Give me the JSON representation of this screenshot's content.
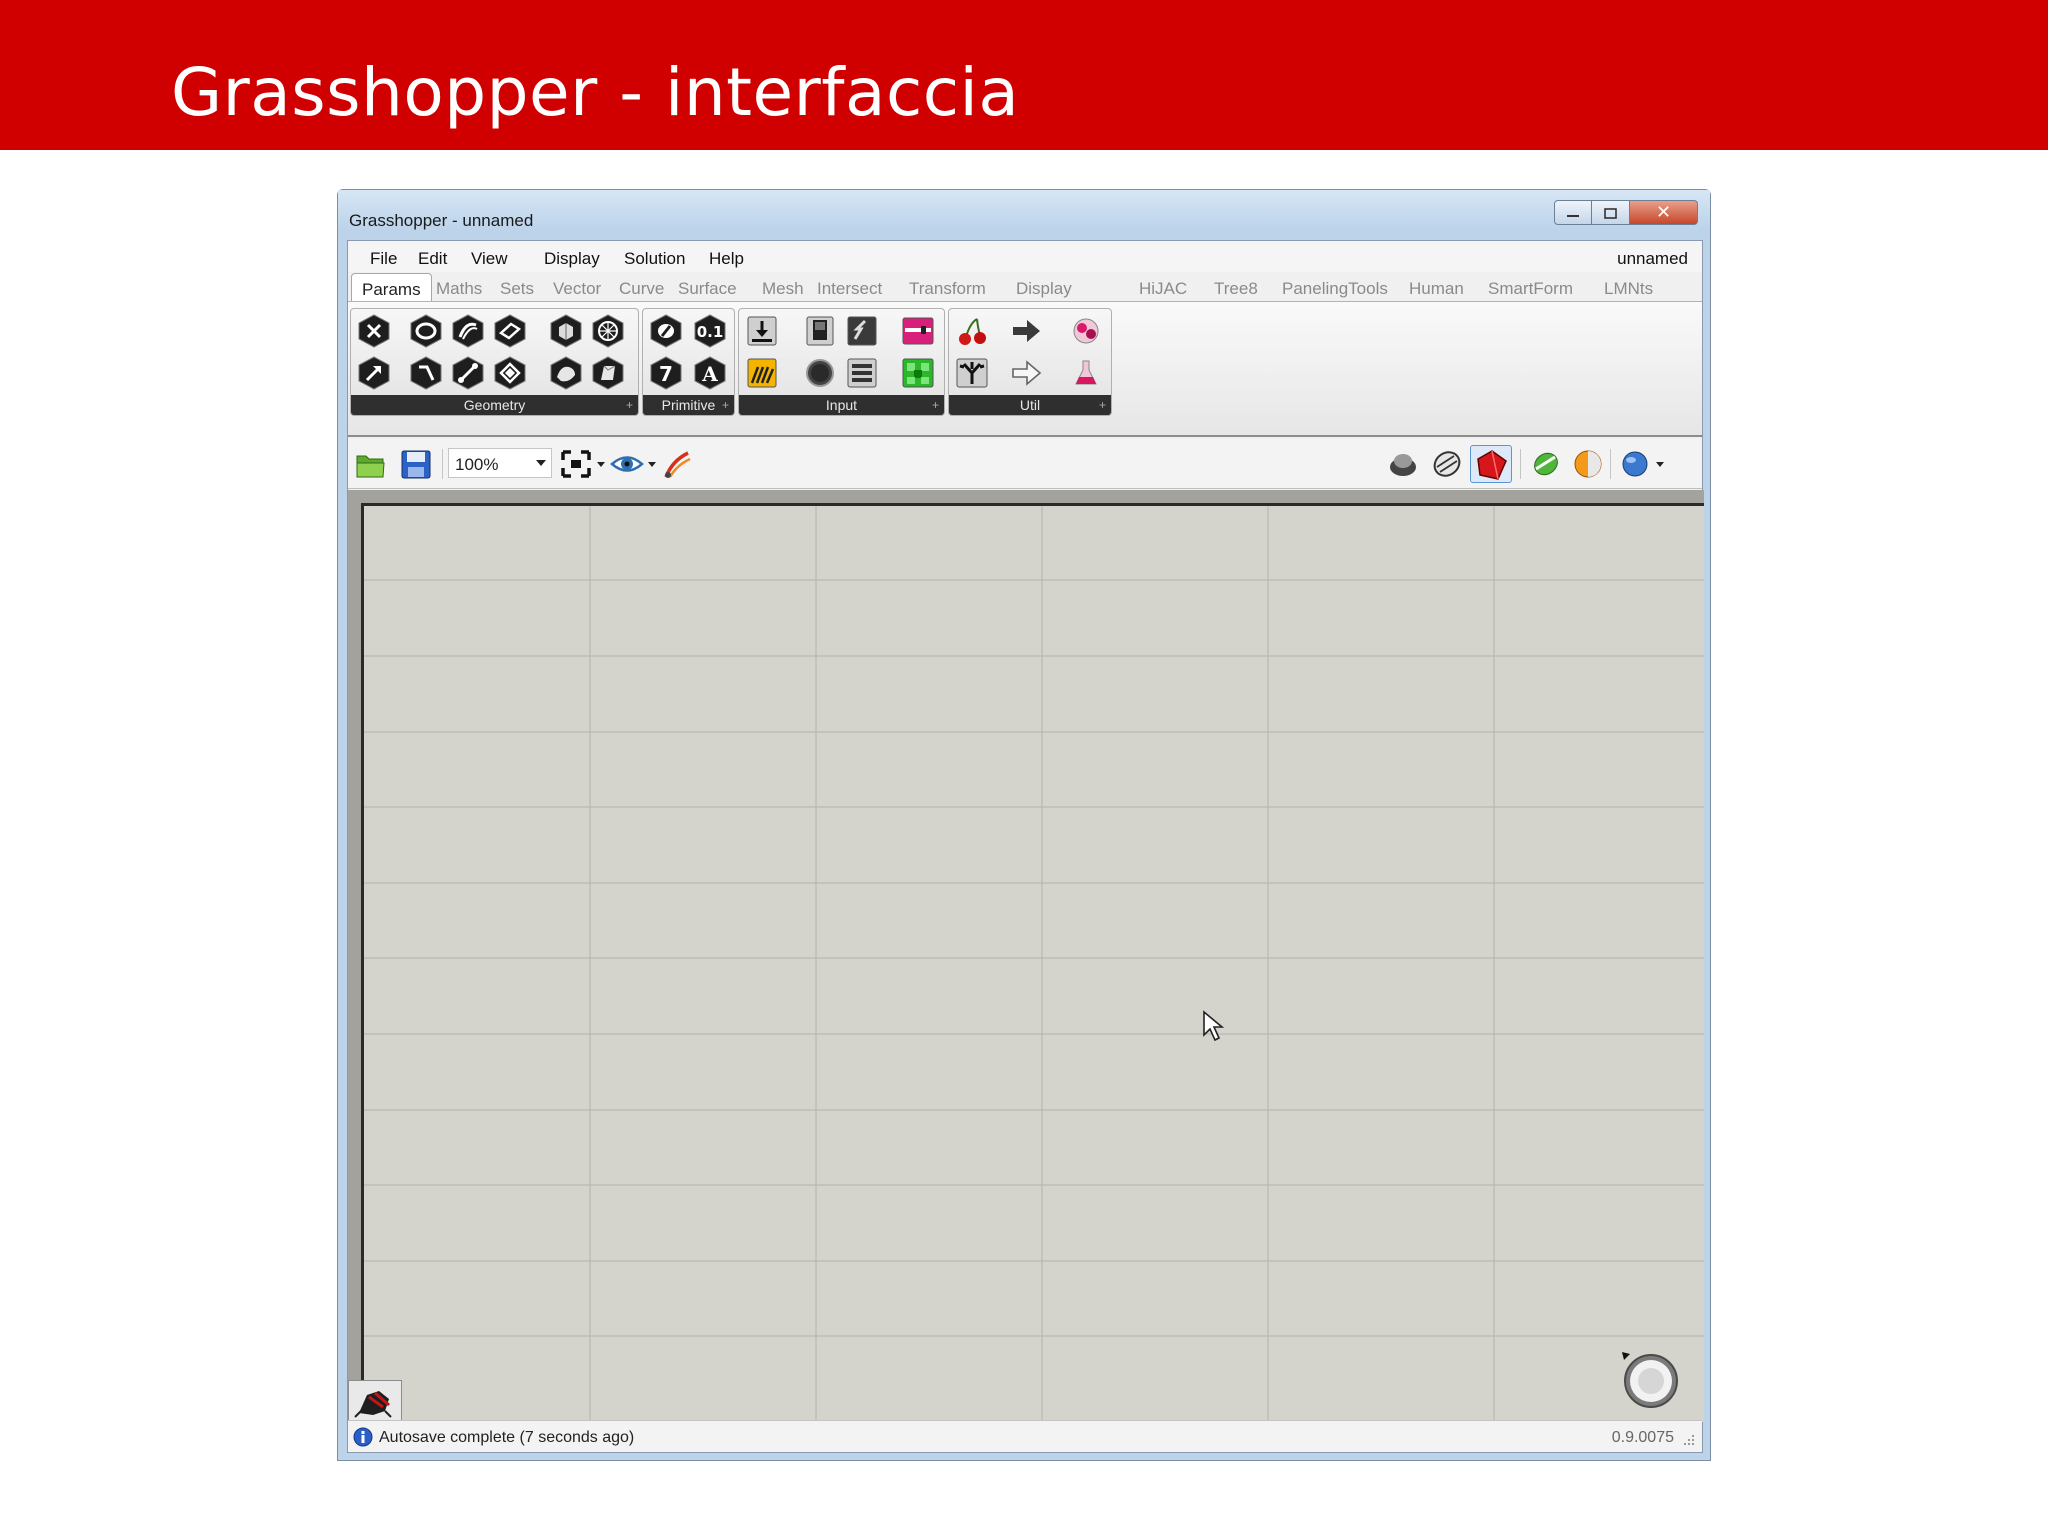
{
  "slide": {
    "title": "Grasshopper - interfaccia"
  },
  "window": {
    "title": "Grasshopper - unnamed",
    "doc_name": "unnamed",
    "close_glyph": "✕"
  },
  "menu": [
    "File",
    "Edit",
    "View",
    "Display",
    "Solution",
    "Help"
  ],
  "tabs": [
    "Params",
    "Maths",
    "Sets",
    "Vector",
    "Curve",
    "Surface",
    "Mesh",
    "Intersect",
    "Transform",
    "Display",
    "HiJAC",
    "Tree8",
    "PanelingTools",
    "Human",
    "SmartForm",
    "LMNts"
  ],
  "active_tab": "Params",
  "ribbon": {
    "groups": [
      {
        "label": "Geometry",
        "icons": [
          "point-icon",
          "circle-icon",
          "circular-arc-icon",
          "box-icon",
          "brep-icon",
          "mesh-icon",
          "vector-icon",
          "curve-icon",
          "line-icon",
          "plane-icon",
          "surface-icon",
          "field-icon"
        ]
      },
      {
        "label": "Primitive",
        "icons": [
          "boolean-icon",
          "number-icon",
          "integer-icon",
          "text-icon"
        ]
      },
      {
        "label": "Input",
        "icons": [
          "import-icon",
          "toggle-icon",
          "slider-icon",
          "gradient-icon",
          "graph-mapper-icon",
          "colour-swatch-icon",
          "value-list-icon",
          "image-sampler-icon"
        ]
      },
      {
        "label": "Util",
        "icons": [
          "cherry-picker-icon",
          "relay-icon",
          "fitness-icon",
          "tree-icon",
          "data-output-icon",
          "flask-icon"
        ]
      }
    ]
  },
  "toolbar": {
    "zoom": "100%"
  },
  "status": {
    "message": "Autosave complete (7 seconds ago)",
    "version": "0.9.0075"
  },
  "colors": {
    "header": "#d00000",
    "canvas": "#d4d3cc",
    "window_frame": "#bcd3ea"
  }
}
